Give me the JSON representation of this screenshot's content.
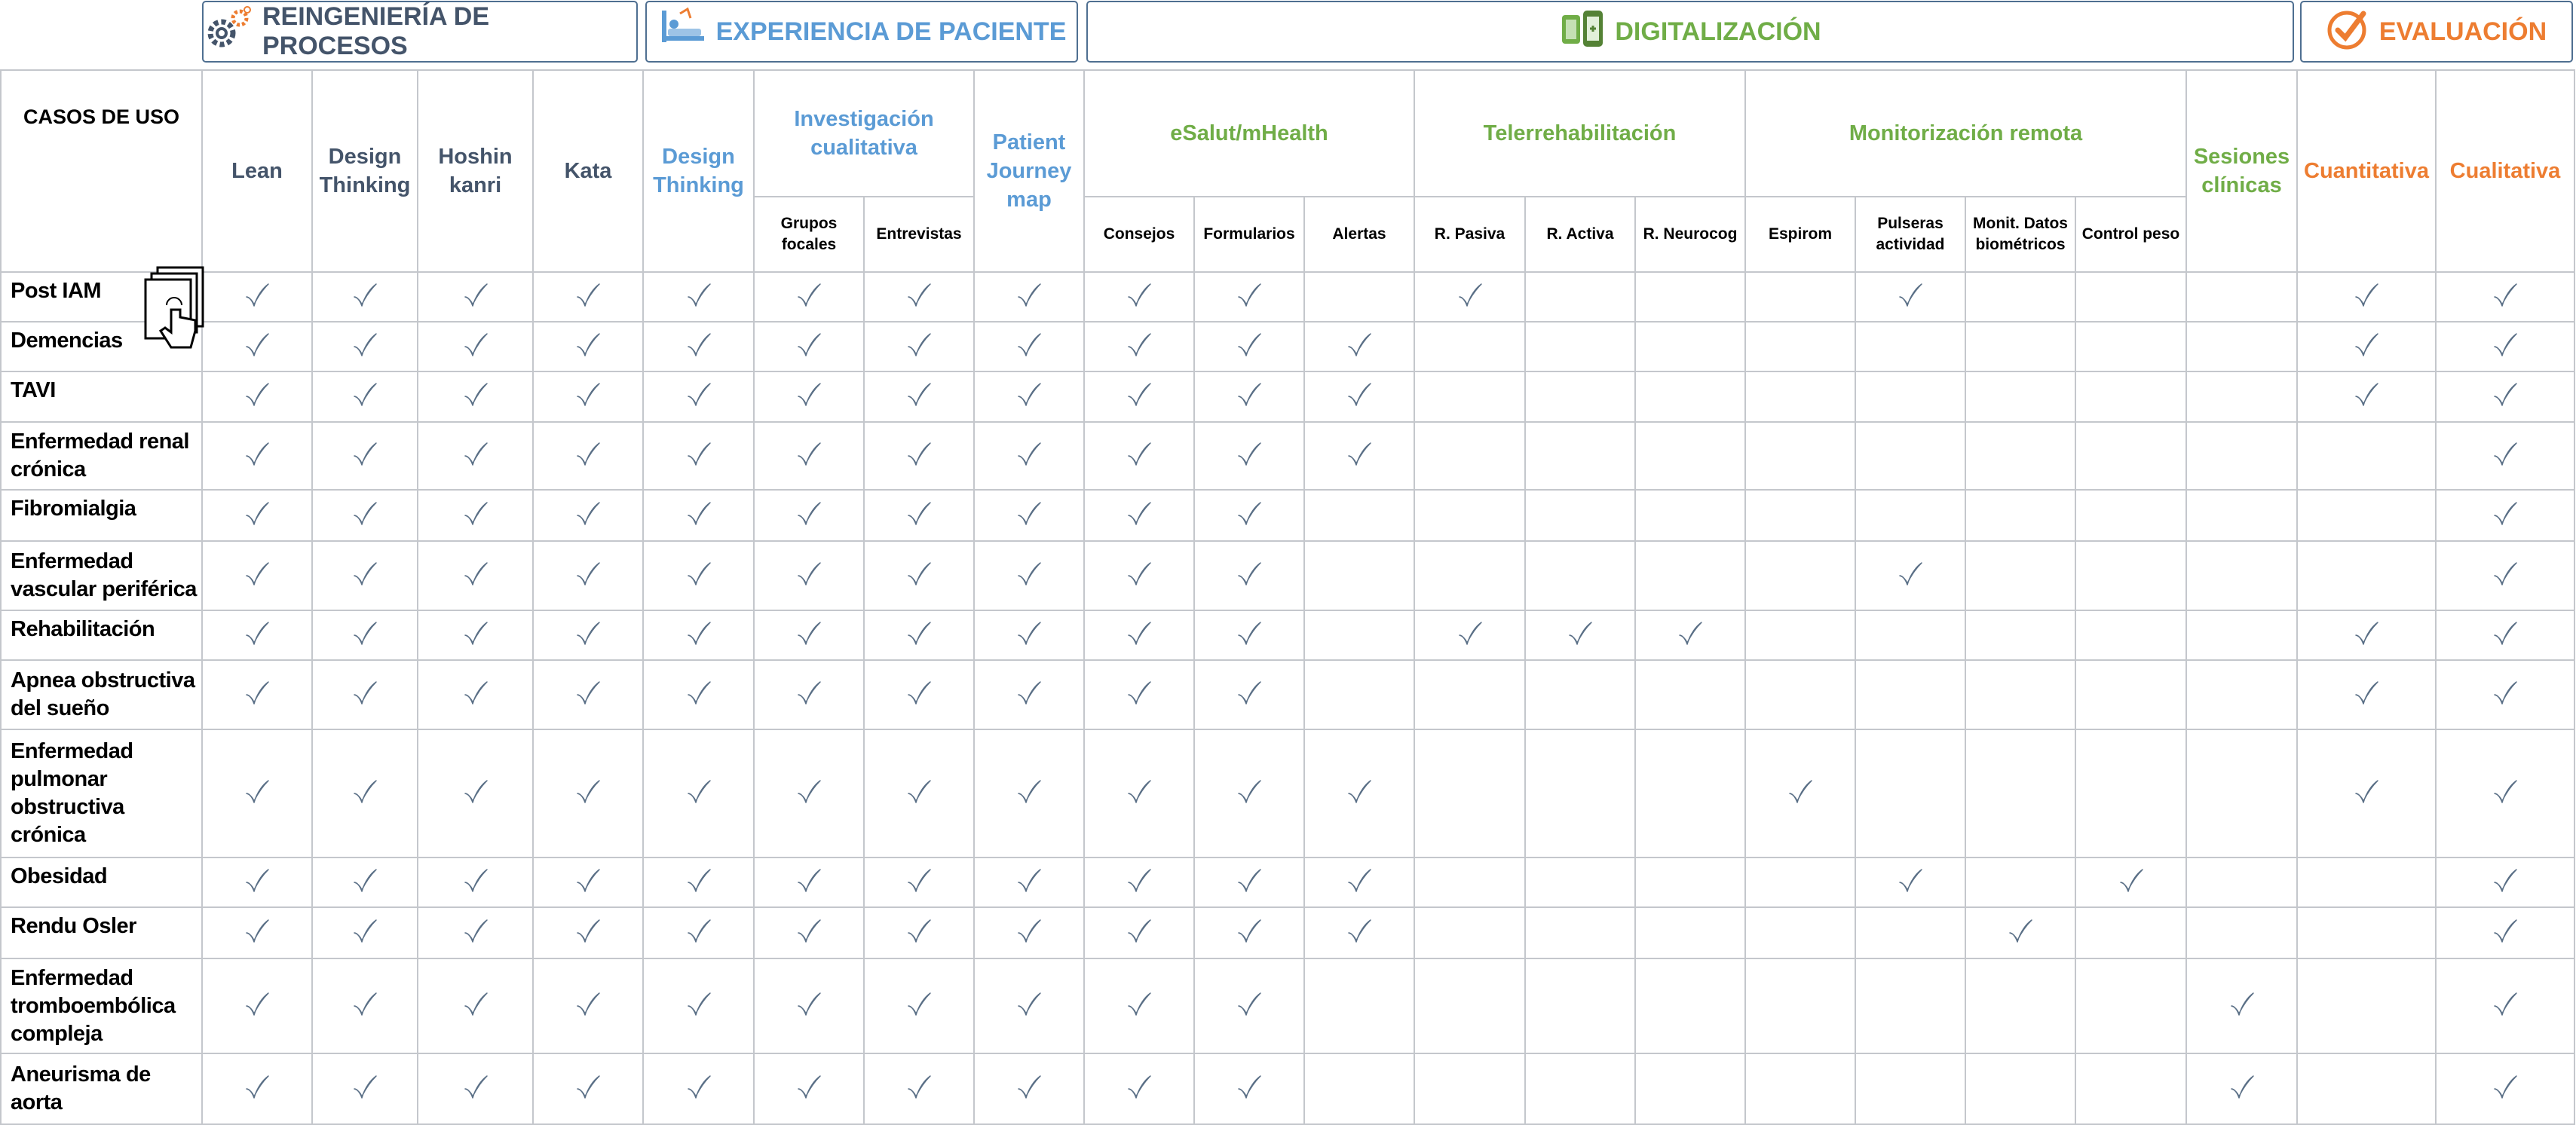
{
  "categories": {
    "reingenieria": "REINGENIERÍA DE PROCESOS",
    "experiencia": "EXPERIENCIA DE PACIENTE",
    "digitalizacion": "DIGITALIZACIÓN",
    "evaluacion": "EVALUACIÓN"
  },
  "colors": {
    "reingenieria": "#44546a",
    "experiencia": "#5b9bd5",
    "digitalizacion": "#70ad47",
    "evaluacion": "#ed7d31",
    "check": "#5a6f86"
  },
  "header": {
    "casos": "CASOS DE USO",
    "lean": "Lean",
    "dt1": "Design Thinking",
    "hoshin": "Hoshin kanri",
    "kata": "Kata",
    "dt2": "Design Thinking",
    "inv": "Investigación cualitativa",
    "grupos": "Grupos focales",
    "entrevistas": "Entrevistas",
    "pjm": "Patient Journey map",
    "esalut": "eSalut/mHealth",
    "consejos": "Consejos",
    "formularios": "Formularios",
    "alertas": "Alertas",
    "telere": "Telerrehabilitación",
    "pasiva": "R. Pasiva",
    "activa": "R. Activa",
    "neurocog": "R. Neurocog",
    "monit": "Monitorización remota",
    "espirom": "Espirom",
    "pulseras": "Pulseras actividad",
    "datos": "Monit. Datos biométricos",
    "peso": "Control peso",
    "sesiones": "Sesiones clínicas",
    "cuanti": "Cuantitativa",
    "cuali": "Cualitativa"
  },
  "rows": [
    {
      "name": "Post IAM",
      "checks": [
        1,
        1,
        1,
        1,
        1,
        1,
        1,
        1,
        1,
        1,
        0,
        1,
        0,
        0,
        0,
        1,
        0,
        0,
        0,
        1,
        1
      ]
    },
    {
      "name": "Demencias",
      "checks": [
        1,
        1,
        1,
        1,
        1,
        1,
        1,
        1,
        1,
        1,
        1,
        0,
        0,
        0,
        0,
        0,
        0,
        0,
        0,
        1,
        1
      ]
    },
    {
      "name": "TAVI",
      "checks": [
        1,
        1,
        1,
        1,
        1,
        1,
        1,
        1,
        1,
        1,
        1,
        0,
        0,
        0,
        0,
        0,
        0,
        0,
        0,
        1,
        1
      ]
    },
    {
      "name": "Enfermedad renal crónica",
      "checks": [
        1,
        1,
        1,
        1,
        1,
        1,
        1,
        1,
        1,
        1,
        1,
        0,
        0,
        0,
        0,
        0,
        0,
        0,
        0,
        0,
        1
      ]
    },
    {
      "name": "Fibromialgia",
      "checks": [
        1,
        1,
        1,
        1,
        1,
        1,
        1,
        1,
        1,
        1,
        0,
        0,
        0,
        0,
        0,
        0,
        0,
        0,
        0,
        0,
        1
      ]
    },
    {
      "name": "Enfermedad vascular periférica",
      "checks": [
        1,
        1,
        1,
        1,
        1,
        1,
        1,
        1,
        1,
        1,
        0,
        0,
        0,
        0,
        0,
        1,
        0,
        0,
        0,
        0,
        1
      ]
    },
    {
      "name": "Rehabilitación",
      "checks": [
        1,
        1,
        1,
        1,
        1,
        1,
        1,
        1,
        1,
        1,
        0,
        1,
        1,
        1,
        0,
        0,
        0,
        0,
        0,
        1,
        1
      ]
    },
    {
      "name": "Apnea obstructiva del sueño",
      "checks": [
        1,
        1,
        1,
        1,
        1,
        1,
        1,
        1,
        1,
        1,
        0,
        0,
        0,
        0,
        0,
        0,
        0,
        0,
        0,
        1,
        1
      ]
    },
    {
      "name": "Enfermedad pulmonar obstructiva crónica",
      "checks": [
        1,
        1,
        1,
        1,
        1,
        1,
        1,
        1,
        1,
        1,
        1,
        0,
        0,
        0,
        1,
        0,
        0,
        0,
        0,
        1,
        1
      ]
    },
    {
      "name": "Obesidad",
      "checks": [
        1,
        1,
        1,
        1,
        1,
        1,
        1,
        1,
        1,
        1,
        1,
        0,
        0,
        0,
        0,
        1,
        0,
        1,
        0,
        0,
        1
      ]
    },
    {
      "name": "Rendu Osler",
      "checks": [
        1,
        1,
        1,
        1,
        1,
        1,
        1,
        1,
        1,
        1,
        1,
        0,
        0,
        0,
        0,
        0,
        1,
        0,
        0,
        0,
        1
      ]
    },
    {
      "name": "Enfermedad tromboembólica compleja",
      "checks": [
        1,
        1,
        1,
        1,
        1,
        1,
        1,
        1,
        1,
        1,
        0,
        0,
        0,
        0,
        0,
        0,
        0,
        0,
        1,
        0,
        1
      ]
    },
    {
      "name": "Aneurisma de aorta",
      "checks": [
        1,
        1,
        1,
        1,
        1,
        1,
        1,
        1,
        1,
        1,
        0,
        0,
        0,
        0,
        0,
        0,
        0,
        0,
        1,
        0,
        1
      ]
    }
  ]
}
